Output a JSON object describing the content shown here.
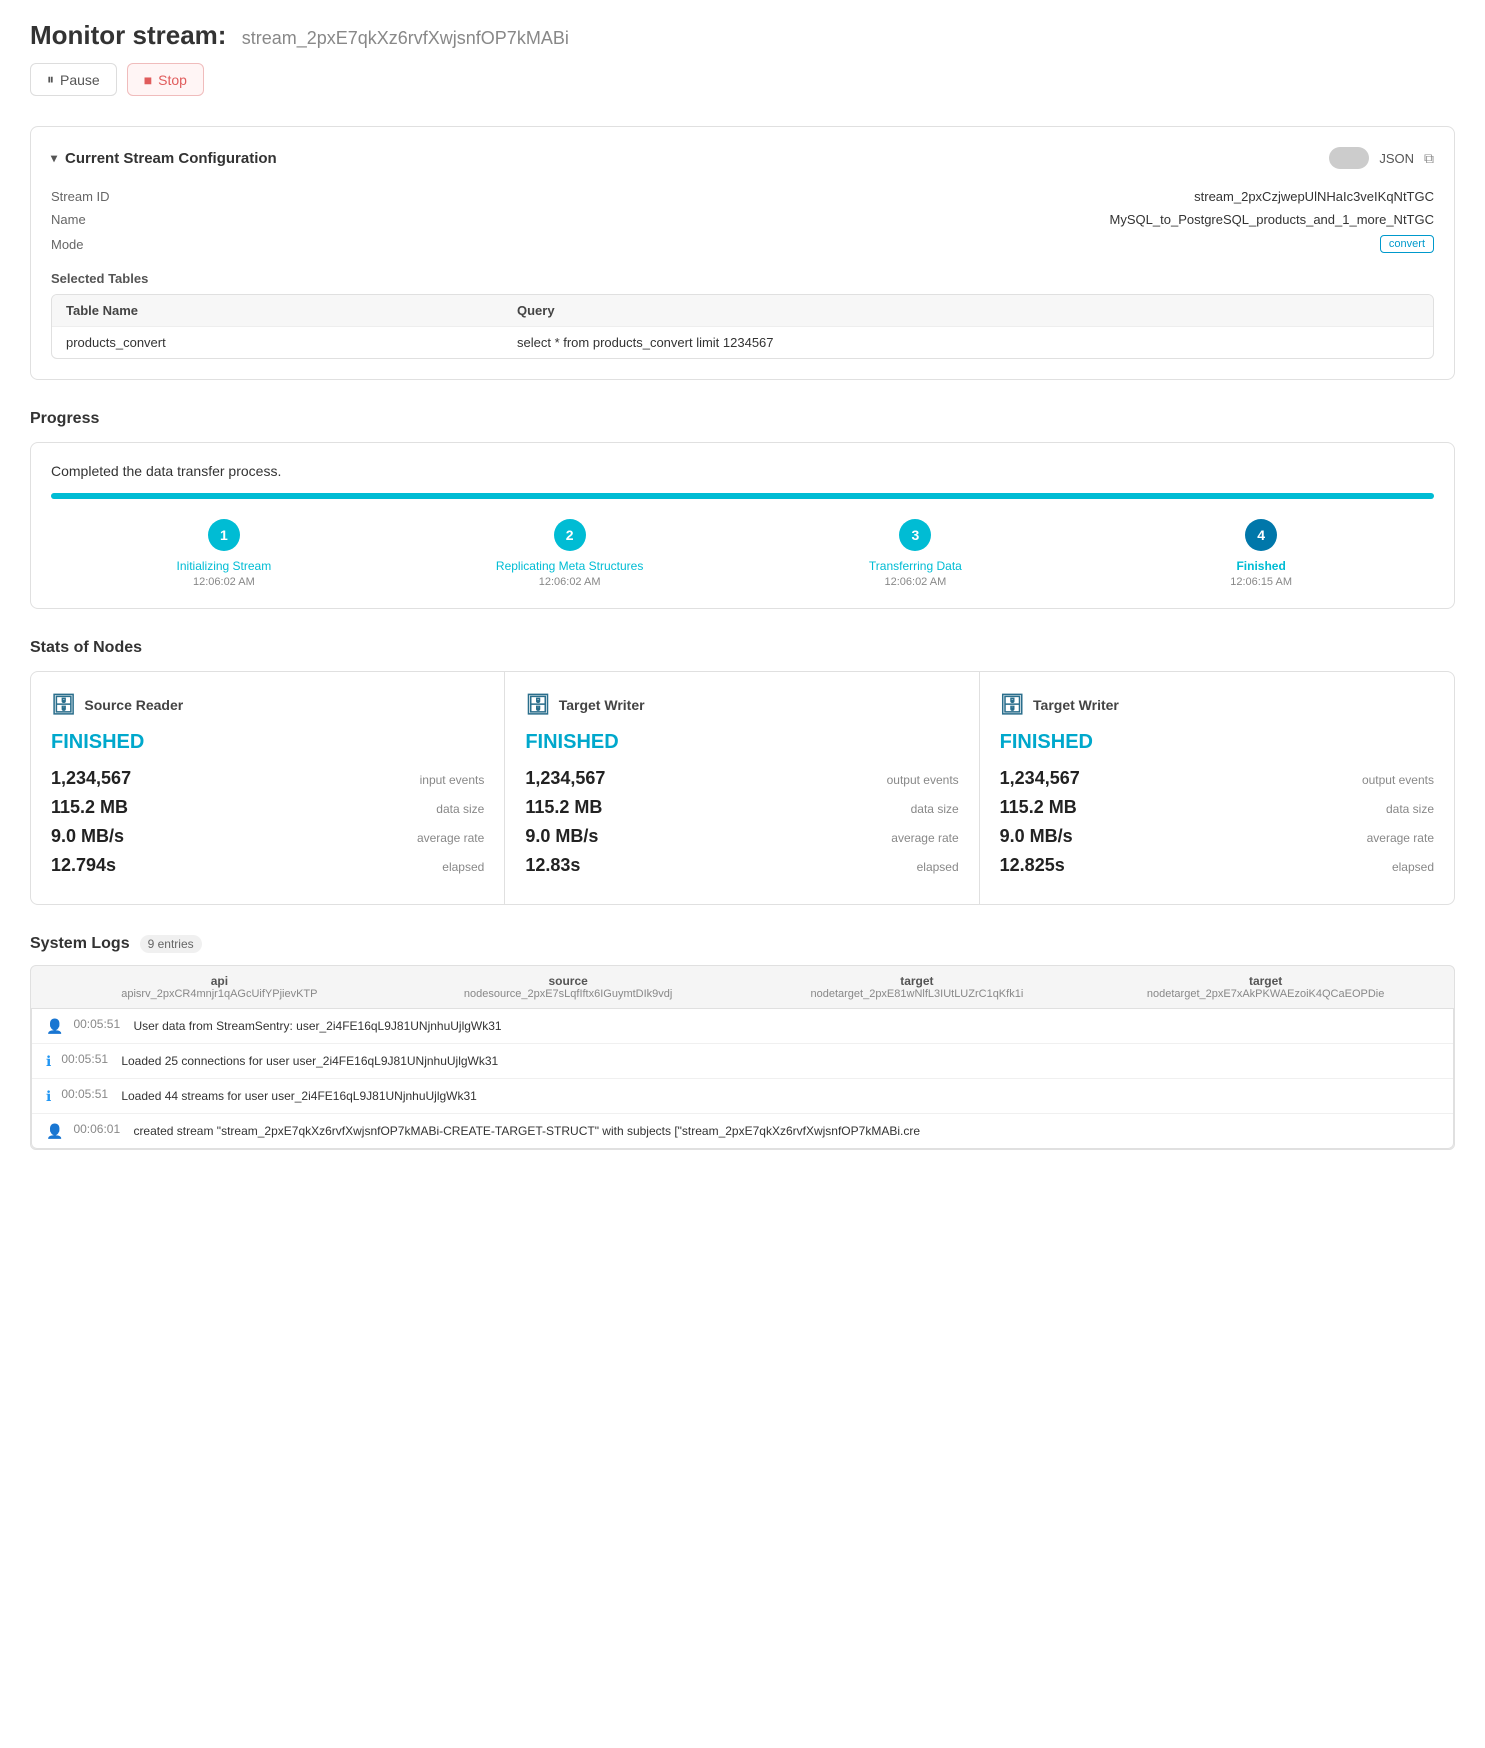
{
  "header": {
    "title": "Monitor stream:",
    "stream_id": "stream_2pxE7qkXz6rvfXwjsnfOP7kMABi"
  },
  "toolbar": {
    "pause_label": "Pause",
    "stop_label": "Stop"
  },
  "config": {
    "section_title": "Current Stream Configuration",
    "json_label": "JSON",
    "stream_id_label": "Stream ID",
    "stream_id_value": "stream_2pxCzjwepUlNHaIc3veIKqNtTGC",
    "name_label": "Name",
    "name_value": "MySQL_to_PostgreSQL_products_and_1_more_NtTGC",
    "mode_label": "Mode",
    "mode_value": "convert",
    "selected_tables_label": "Selected Tables",
    "table_col_name": "Table Name",
    "table_col_query": "Query",
    "tables": [
      {
        "name": "products_convert",
        "query": "select * from products_convert limit 1234567"
      }
    ]
  },
  "progress": {
    "section_title": "Progress",
    "message": "Completed the data transfer process.",
    "fill_percent": 100,
    "steps": [
      {
        "num": "1",
        "label": "Initializing Stream",
        "time": "12:06:02 AM"
      },
      {
        "num": "2",
        "label": "Replicating Meta Structures",
        "time": "12:06:02 AM"
      },
      {
        "num": "3",
        "label": "Transferring Data",
        "time": "12:06:02 AM"
      },
      {
        "num": "4",
        "label": "Finished",
        "time": "12:06:15 AM"
      }
    ]
  },
  "stats": {
    "section_title": "Stats of Nodes",
    "nodes": [
      {
        "type": "Source Reader",
        "status": "FINISHED",
        "metrics": [
          {
            "value": "1,234,567",
            "label": "input events"
          },
          {
            "value": "115.2 MB",
            "label": "data size"
          },
          {
            "value": "9.0 MB/s",
            "label": "average rate"
          },
          {
            "value": "12.794s",
            "label": "elapsed"
          }
        ]
      },
      {
        "type": "Target Writer",
        "status": "FINISHED",
        "metrics": [
          {
            "value": "1,234,567",
            "label": "output events"
          },
          {
            "value": "115.2 MB",
            "label": "data size"
          },
          {
            "value": "9.0 MB/s",
            "label": "average rate"
          },
          {
            "value": "12.83s",
            "label": "elapsed"
          }
        ]
      },
      {
        "type": "Target Writer",
        "status": "FINISHED",
        "metrics": [
          {
            "value": "1,234,567",
            "label": "output events"
          },
          {
            "value": "115.2 MB",
            "label": "data size"
          },
          {
            "value": "9.0 MB/s",
            "label": "average rate"
          },
          {
            "value": "12.825s",
            "label": "elapsed"
          }
        ]
      }
    ]
  },
  "logs": {
    "section_title": "System Logs",
    "entries_badge": "9 entries",
    "columns": [
      {
        "main": "api",
        "sub": "apisrv_2pxCR4mnjr1qAGcUifYPjievKTP"
      },
      {
        "main": "source",
        "sub": "nodesource_2pxE7sLqfIftx6IGuymtDIk9vdj"
      },
      {
        "main": "target",
        "sub": "nodetarget_2pxE81wNlfL3IUtLUZrC1qKfk1i"
      },
      {
        "main": "target",
        "sub": "nodetarget_2pxE7xAkPKWAEzoiK4QCaEOPDie"
      }
    ],
    "entries": [
      {
        "icon": "user",
        "time": "00:05:51",
        "text": "User data from StreamSentry: user_2i4FE16qL9J81UNjnhuUjlgWk31"
      },
      {
        "icon": "info",
        "time": "00:05:51",
        "text": "Loaded 25 connections for user user_2i4FE16qL9J81UNjnhuUjlgWk31"
      },
      {
        "icon": "info",
        "time": "00:05:51",
        "text": "Loaded 44 streams for user user_2i4FE16qL9J81UNjnhuUjlgWk31"
      },
      {
        "icon": "user",
        "time": "00:06:01",
        "text": "created stream \"stream_2pxE7qkXz6rvfXwjsnfOP7kMABi-CREATE-TARGET-STRUCT\" with subjects [\"stream_2pxE7qkXz6rvfXwjsnfOP7kMABi.cre"
      }
    ]
  }
}
